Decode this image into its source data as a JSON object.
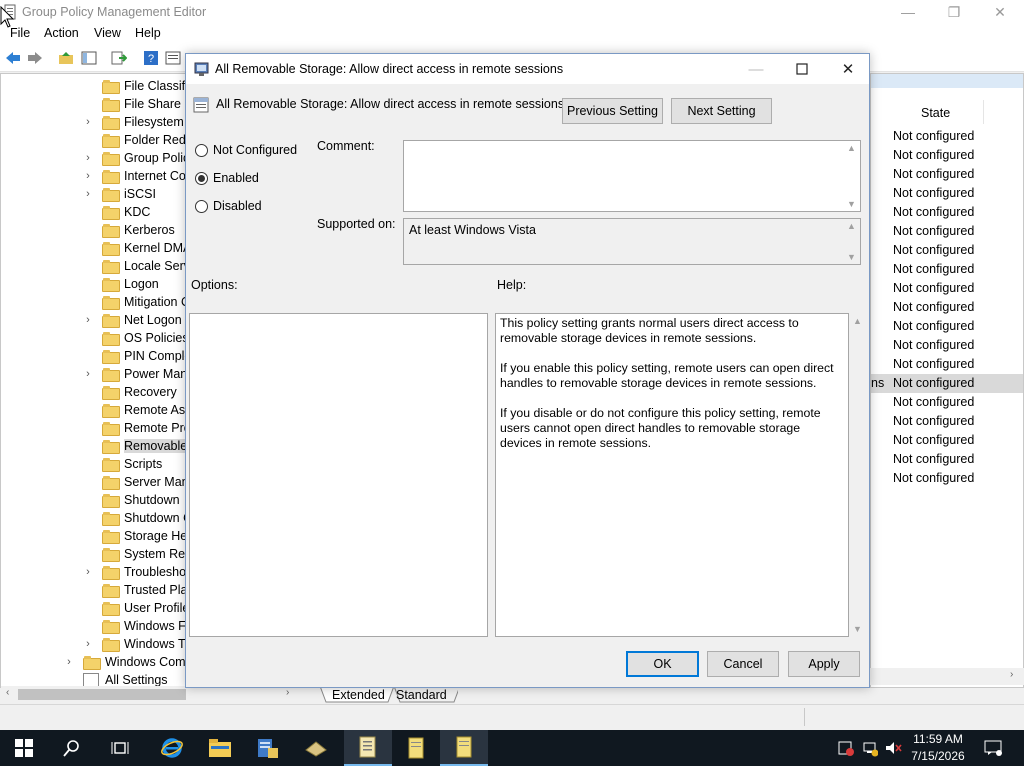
{
  "main_window": {
    "title": "Group Policy Management Editor",
    "controls": {
      "minimize": "—",
      "restore": "❐",
      "close": "✕"
    }
  },
  "menubar": {
    "items": [
      "File",
      "Action",
      "View",
      "Help"
    ]
  },
  "tree": {
    "items": [
      {
        "label": "File Classific",
        "expandable": false
      },
      {
        "label": "File Share Sh",
        "expandable": false
      },
      {
        "label": "Filesystem",
        "expandable": true
      },
      {
        "label": "Folder Redire",
        "expandable": false
      },
      {
        "label": "Group Policy",
        "expandable": true
      },
      {
        "label": "Internet Com",
        "expandable": true
      },
      {
        "label": "iSCSI",
        "expandable": true
      },
      {
        "label": "KDC",
        "expandable": false
      },
      {
        "label": "Kerberos",
        "expandable": false
      },
      {
        "label": "Kernel DMA",
        "expandable": false
      },
      {
        "label": "Locale Servic",
        "expandable": false
      },
      {
        "label": "Logon",
        "expandable": false
      },
      {
        "label": "Mitigation O",
        "expandable": false
      },
      {
        "label": "Net Logon",
        "expandable": true
      },
      {
        "label": "OS Policies",
        "expandable": false
      },
      {
        "label": "PIN Comple",
        "expandable": false
      },
      {
        "label": "Power Mana",
        "expandable": true
      },
      {
        "label": "Recovery",
        "expandable": false
      },
      {
        "label": "Remote Assi",
        "expandable": false
      },
      {
        "label": "Remote Proc",
        "expandable": false
      },
      {
        "label": "Removable S",
        "expandable": false,
        "selected": true
      },
      {
        "label": "Scripts",
        "expandable": false
      },
      {
        "label": "Server Mana",
        "expandable": false
      },
      {
        "label": "Shutdown",
        "expandable": false
      },
      {
        "label": "Shutdown O",
        "expandable": false
      },
      {
        "label": "Storage Hea",
        "expandable": false
      },
      {
        "label": "System Rest",
        "expandable": false
      },
      {
        "label": "Troublesho",
        "expandable": true
      },
      {
        "label": "Trusted Platf",
        "expandable": false
      },
      {
        "label": "User Profiles",
        "expandable": false
      },
      {
        "label": "Windows Fil",
        "expandable": false
      },
      {
        "label": "Windows Tir",
        "expandable": true
      }
    ],
    "parent_items": [
      {
        "label": "Windows Comp",
        "expandable": true
      },
      {
        "label": "All Settings",
        "expandable": false
      }
    ]
  },
  "right_pane": {
    "column_header": "State",
    "partial_text": "ns",
    "states": [
      "Not configured",
      "Not configured",
      "Not configured",
      "Not configured",
      "Not configured",
      "Not configured",
      "Not configured",
      "Not configured",
      "Not configured",
      "Not configured",
      "Not configured",
      "Not configured",
      "Not configured",
      "Not configured",
      "Not configured",
      "Not configured",
      "Not configured",
      "Not configured",
      "Not configured"
    ]
  },
  "tabs": {
    "extended": "Extended",
    "standard": "Standard"
  },
  "dialog": {
    "title": "All Removable Storage: Allow direct access in remote sessions",
    "policy_name": "All Removable Storage: Allow direct access in remote sessions",
    "previous_button": "Previous Setting",
    "next_button": "Next Setting",
    "radio_not_configured": "Not Configured",
    "radio_enabled": "Enabled",
    "radio_disabled": "Disabled",
    "selected_option": "Enabled",
    "comment_label": "Comment:",
    "comment_value": "",
    "supported_label": "Supported on:",
    "supported_value": "At least Windows Vista",
    "options_label": "Options:",
    "help_label": "Help:",
    "help_paragraphs": [
      "This policy setting grants normal users direct access to removable storage devices in remote sessions.",
      "If you enable this policy setting, remote users can open direct handles to removable storage devices in remote sessions.",
      "If you disable or do not configure this policy setting, remote users cannot open direct handles to removable storage devices in remote sessions."
    ],
    "ok_button": "OK",
    "cancel_button": "Cancel",
    "apply_button": "Apply"
  },
  "taskbar": {
    "time": "11:59 AM",
    "date": "7/15/2026"
  }
}
